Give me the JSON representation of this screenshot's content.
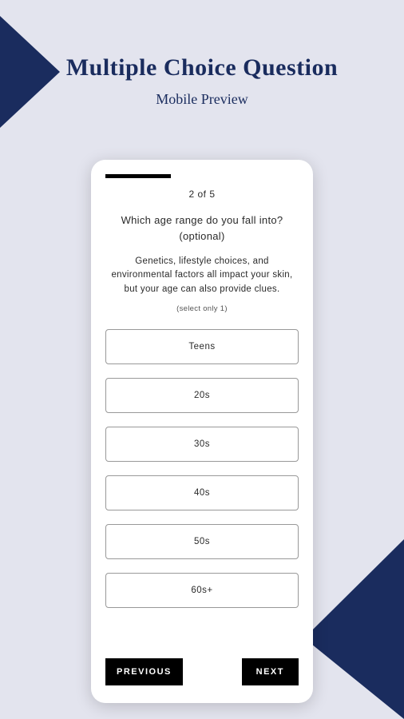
{
  "header": {
    "title": "Multiple Choice Question",
    "subtitle": "Mobile Preview"
  },
  "quiz": {
    "progress_percent": 34,
    "step_counter": "2  of  5",
    "question": "Which age range do you fall into? (optional)",
    "description": "Genetics, lifestyle choices, and environmental factors all impact your skin, but your age can also provide clues.",
    "select_hint": "(select only 1)",
    "options": [
      {
        "label": "Teens"
      },
      {
        "label": "20s"
      },
      {
        "label": "30s"
      },
      {
        "label": "40s"
      },
      {
        "label": "50s"
      },
      {
        "label": "60s+"
      }
    ],
    "prev_label": "PREVIOUS",
    "next_label": "NEXT"
  }
}
